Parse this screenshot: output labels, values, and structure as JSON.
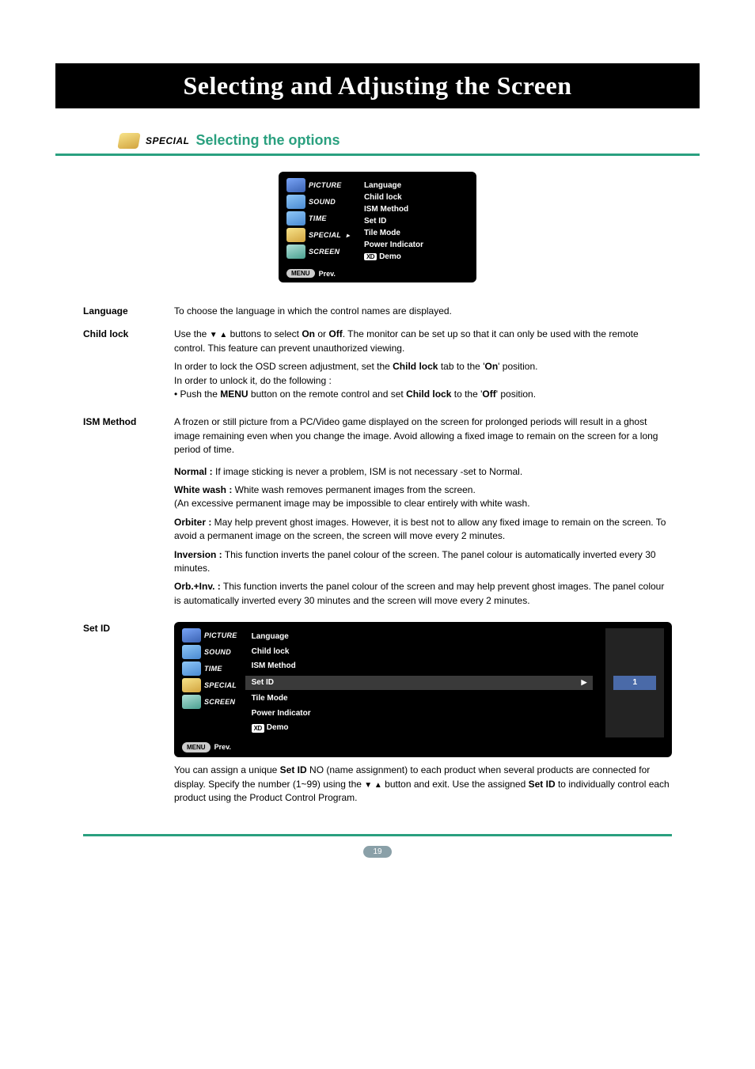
{
  "title_bar": "Selecting and Adjusting the Screen",
  "section": {
    "badge_label": "SPECIAL",
    "title": "Selecting the options"
  },
  "osd_main": {
    "tabs": [
      "PICTURE",
      "SOUND",
      "TIME",
      "SPECIAL",
      "SCREEN"
    ],
    "items": [
      "Language",
      "Child lock",
      "ISM Method",
      "Set ID",
      "Tile Mode",
      "Power Indicator"
    ],
    "demo_prefix": "XD",
    "demo_label": "Demo",
    "footer_menu": "MENU",
    "footer_prev": "Prev."
  },
  "rows": {
    "language": {
      "label": "Language",
      "body": "To choose the language in which the control names are displayed."
    },
    "childlock": {
      "label": "Child lock",
      "p1_a": "Use the ",
      "p1_b": " buttons to select ",
      "p1_on": "On",
      "p1_or": " or ",
      "p1_off": "Off",
      "p1_c": ". The monitor can be set up so that it can only be used with the remote control. This feature can prevent unauthorized viewing.",
      "p2_a": "In order to lock the OSD screen adjustment, set the ",
      "p2_bold": "Child lock",
      "p2_b": " tab to the '",
      "p2_on": "On",
      "p2_c": "' position.",
      "p3": "In order to unlock it, do the following :",
      "p4_a": "• Push the ",
      "p4_menu": "MENU",
      "p4_b": " button on the remote control and set ",
      "p4_cl": "Child lock",
      "p4_c": " to the '",
      "p4_off": "Off",
      "p4_d": "' position."
    },
    "ism": {
      "label": "ISM Method",
      "intro": "A frozen or still picture from a PC/Video game displayed on the screen for prolonged periods will result in a ghost image remaining even when you change the image. Avoid allowing a fixed image to remain on the screen for a long period of time.",
      "normal_label": "Normal :",
      "normal_body": " If image sticking is never a problem, ISM is not necessary -set to Normal.",
      "ww_label": "White wash :",
      "ww_body1": "  White wash removes permanent images from the screen.",
      "ww_body2": "(An excessive permanent image may be impossible to clear entirely with white wash.",
      "orbiter_label": "Orbiter :",
      "orbiter_body": " May help prevent ghost images. However, it is best not to allow any fixed image to remain on the screen. To avoid a permanent image on the screen, the screen will move every 2 minutes.",
      "inversion_label": "Inversion :",
      "inversion_body": " This function inverts the panel colour of the screen. The panel colour is automatically inverted every 30 minutes.",
      "orbinv_label": "Orb.+Inv. :",
      "orbinv_body": " This function inverts the panel colour of the screen and may help prevent ghost images. The panel colour is automatically inverted every 30 minutes and the screen will move every 2 minutes."
    },
    "setid": {
      "label": "Set ID",
      "osd": {
        "tabs": [
          "PICTURE",
          "SOUND",
          "TIME",
          "SPECIAL",
          "SCREEN"
        ],
        "items_top": [
          "Language",
          "Child lock",
          "ISM Method"
        ],
        "selected": "Set ID",
        "items_bottom": [
          "Tile Mode",
          "Power Indicator"
        ],
        "value": "1",
        "footer_menu": "MENU",
        "footer_prev": "Prev."
      },
      "body_a": "You can assign a unique ",
      "body_bold1": "Set ID",
      "body_b": " NO (name assignment) to each product when several products are connected for display. Specify the number (1~99) using the ",
      "body_c": " button and exit. Use the assigned ",
      "body_bold2": "Set ID",
      "body_d": " to individually control each product using the Product Control Program."
    }
  },
  "page_number": "19"
}
